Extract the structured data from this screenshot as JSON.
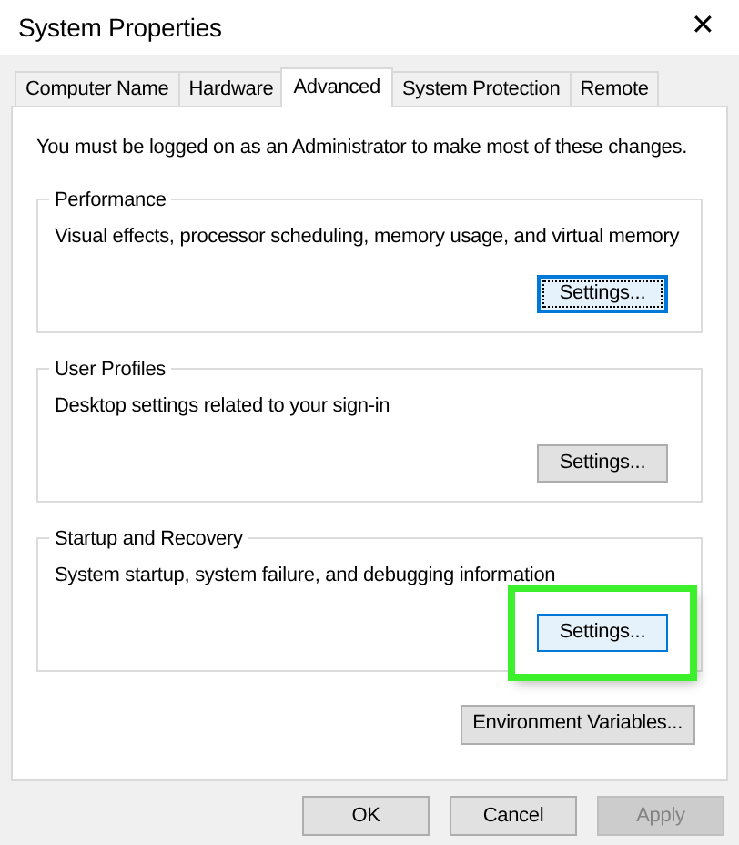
{
  "window": {
    "title": "System Properties",
    "close": "✕"
  },
  "tabs": [
    {
      "label": "Computer Name",
      "selected": false
    },
    {
      "label": "Hardware",
      "selected": false
    },
    {
      "label": "Advanced",
      "selected": true
    },
    {
      "label": "System Protection",
      "selected": false
    },
    {
      "label": "Remote",
      "selected": false
    }
  ],
  "notice": "You must be logged on as an Administrator to make most of these changes.",
  "groups": [
    {
      "title": "Performance",
      "description": "Visual effects, processor scheduling, memory usage, and virtual memory",
      "button": {
        "label": "Settings...",
        "focused": true,
        "highlighted": false
      }
    },
    {
      "title": "User Profiles",
      "description": "Desktop settings related to your sign-in",
      "button": {
        "label": "Settings...",
        "focused": false,
        "highlighted": false
      }
    },
    {
      "title": "Startup and Recovery",
      "description": "System startup, system failure, and debugging information",
      "button": {
        "label": "Settings...",
        "focused": false,
        "highlighted": true
      }
    }
  ],
  "environment_button": "Environment Variables...",
  "buttons": [
    {
      "label": "OK",
      "disabled": false
    },
    {
      "label": "Cancel",
      "disabled": false
    },
    {
      "label": "Apply",
      "disabled": true
    }
  ]
}
